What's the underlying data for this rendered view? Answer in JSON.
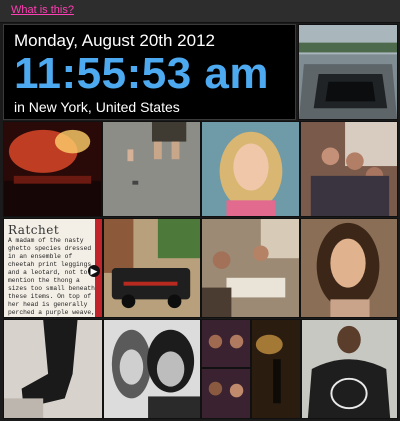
{
  "header": {
    "link_text": "What is this?"
  },
  "clock": {
    "date": "Monday, August 20th 2012",
    "time": "11:55:53 am",
    "location": "in New York, United States"
  },
  "card": {
    "title": "Ratchet",
    "body": "A madam of the nasty ghetto species dressed in an ensemble of cheetah print leggings and a leotard, not to mention the thong a sizes too small beneath these items. On top of her head is generally perched a purple weave, often resembling"
  },
  "colors": {
    "time": "#4eaaf0",
    "link": "#ff3fb4",
    "background": "#1b1b1b"
  },
  "icons": {
    "arrow": "chevron-right-icon"
  }
}
